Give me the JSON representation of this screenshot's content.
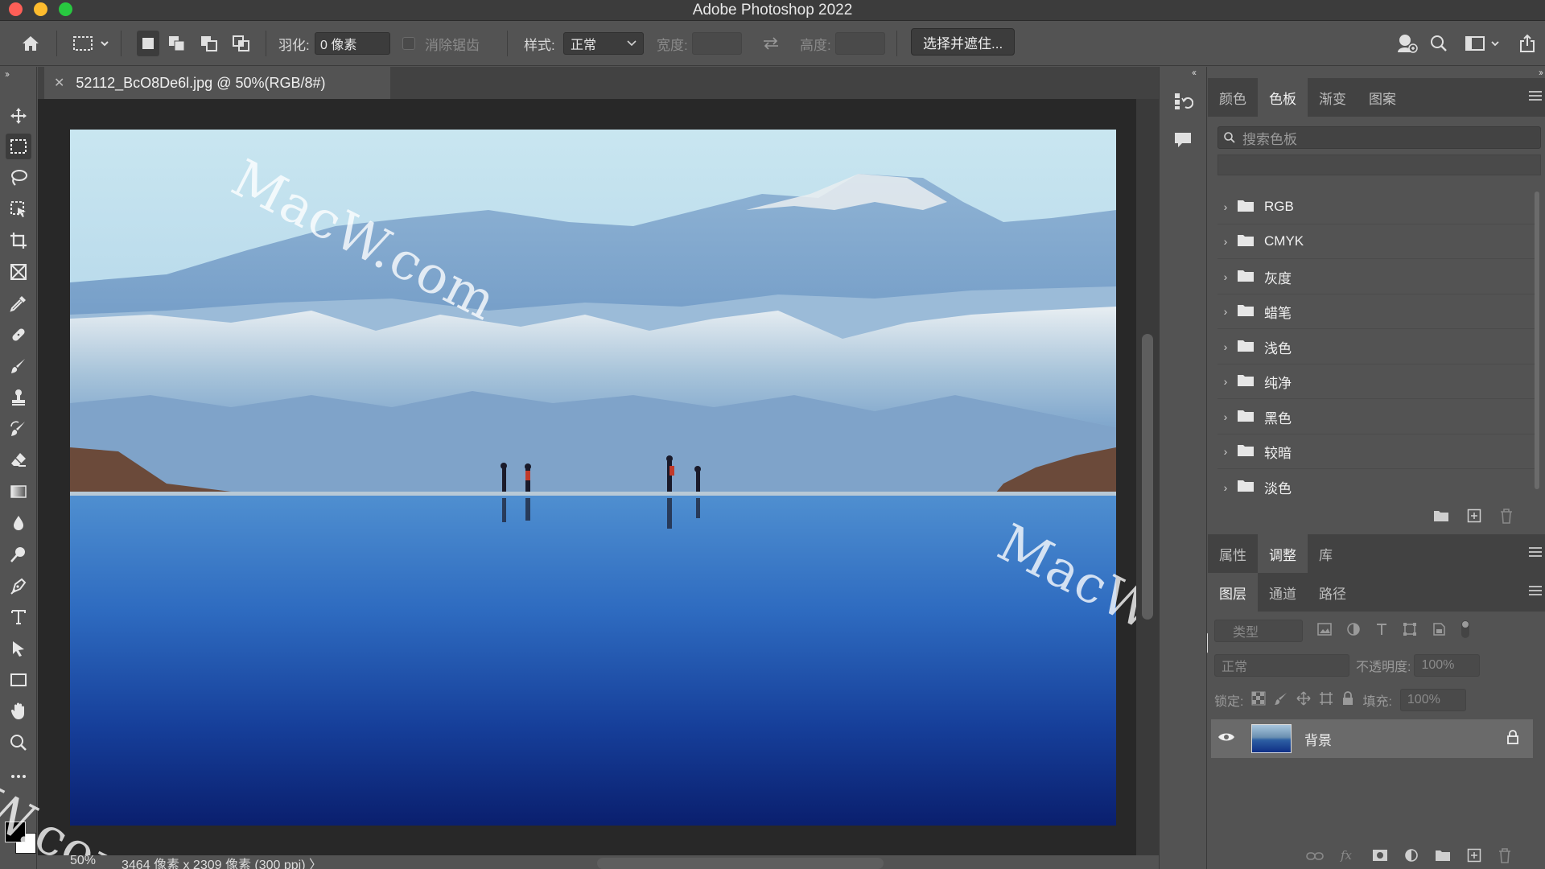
{
  "window": {
    "title": "Adobe Photoshop 2022"
  },
  "options_bar": {
    "feather_label": "羽化:",
    "feather_value": "0 像素",
    "antialias_label": "消除锯齿",
    "style_label": "样式:",
    "style_value": "正常",
    "width_label": "宽度:",
    "height_label": "高度:",
    "select_mask_button": "选择并遮住..."
  },
  "document": {
    "tab_title": "52112_BcO8De6l.jpg @ 50%(RGB/8#)",
    "zoom": "50%",
    "dimensions": "3464 像素 x 2309 像素 (300 ppi)",
    "status_arrow": "〉"
  },
  "watermarks": {
    "text_top": "MacW.com",
    "text_right": "MacW.com",
    "text_bottom": "W.com"
  },
  "swatches_panel": {
    "tabs": [
      "颜色",
      "色板",
      "渐变",
      "图案"
    ],
    "active_tab": "色板",
    "search_placeholder": "搜索色板",
    "groups": [
      "RGB",
      "CMYK",
      "灰度",
      "蜡笔",
      "浅色",
      "纯净",
      "黑色",
      "较暗",
      "淡色"
    ]
  },
  "properties_panel": {
    "tabs": [
      "属性",
      "调整",
      "库"
    ],
    "active_tab": "调整"
  },
  "layers_panel": {
    "tabs": [
      "图层",
      "通道",
      "路径"
    ],
    "active_tab": "图层",
    "kind_filter": "类型",
    "blend_mode": "正常",
    "opacity_label": "不透明度:",
    "opacity_value": "100%",
    "lock_label": "锁定:",
    "fill_label": "填充:",
    "fill_value": "100%",
    "layers": [
      {
        "name": "背景",
        "visible": true,
        "locked": true
      }
    ]
  },
  "colors": {
    "foreground": "#000000",
    "background": "#ffffff",
    "accent_red": "#fe5f57",
    "accent_yellow": "#febc2e",
    "accent_green": "#28c840"
  }
}
